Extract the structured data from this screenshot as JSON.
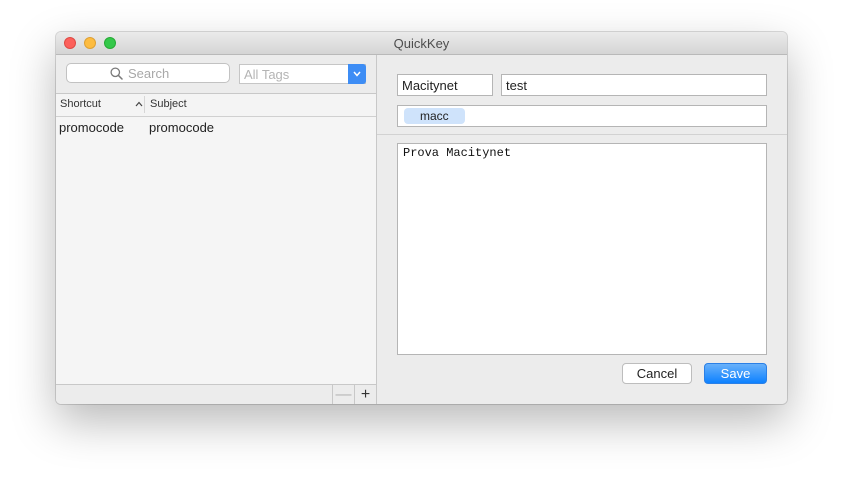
{
  "window": {
    "title": "QuickKey"
  },
  "left_pane": {
    "search": {
      "placeholder": "Search"
    },
    "tags_filter": {
      "selected": "All Tags"
    },
    "table": {
      "columns": [
        "Shortcut",
        "Subject"
      ],
      "rows": [
        {
          "shortcut": "promocode",
          "subject": "promocode"
        }
      ]
    },
    "bottom_bar": {
      "remove_label": "—",
      "add_label": "+"
    }
  },
  "editor": {
    "shortcut_value": "Macitynet",
    "subject_value": "test",
    "tags": [
      "macc"
    ],
    "body_text": "Prova Macitynet",
    "cancel_label": "Cancel",
    "save_label": "Save"
  },
  "colors": {
    "accent": "#3d8df5",
    "token_bg": "#cfe3fb"
  }
}
